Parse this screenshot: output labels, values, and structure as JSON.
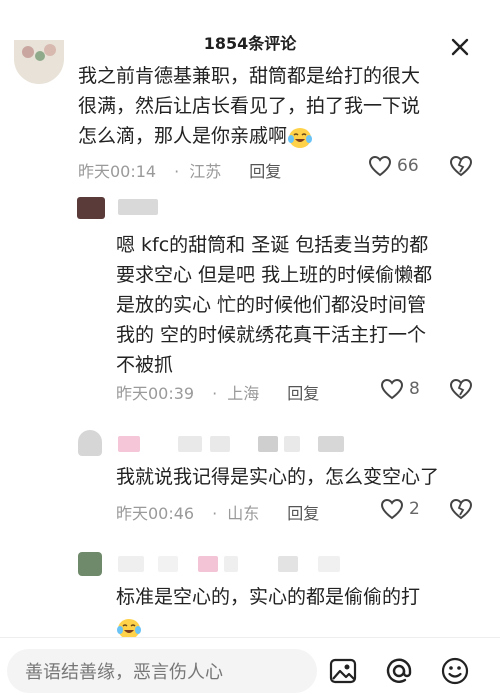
{
  "header": {
    "title": "1854条评论"
  },
  "comments": [
    {
      "text_lines": [
        "我之前肯德基兼职，甜筒都是给打的很大",
        "很满，然后让店长看见了，拍了我一下说",
        "怎么滴，那人是你亲戚啊"
      ],
      "time": "昨天00:14",
      "location": "江苏",
      "reply_label": "回复",
      "likes": "66"
    },
    {
      "text_lines": [
        "嗯 kfc的甜筒和 圣诞 包括麦当劳的都",
        "要求空心 但是吧 我上班的时候偷懒都",
        "是放的实心  忙的时候他们都没时间管",
        "我的 空的时候就绣花真干活主打一个",
        "不被抓"
      ],
      "time": "昨天00:39",
      "location": "上海",
      "reply_label": "回复",
      "likes": "8"
    },
    {
      "text_lines": [
        "我就说我记得是实心的，怎么变空心了"
      ],
      "time": "昨天00:46",
      "location": "山东",
      "reply_label": "回复",
      "likes": "2"
    },
    {
      "text_lines": [
        "标准是空心的，实心的都是偷偷的打"
      ]
    }
  ],
  "bottom": {
    "input_placeholder": "善语结善缘，恶言伤人心"
  },
  "colors": {
    "meta": "#9a9a9a",
    "bg": "#ffffff"
  }
}
